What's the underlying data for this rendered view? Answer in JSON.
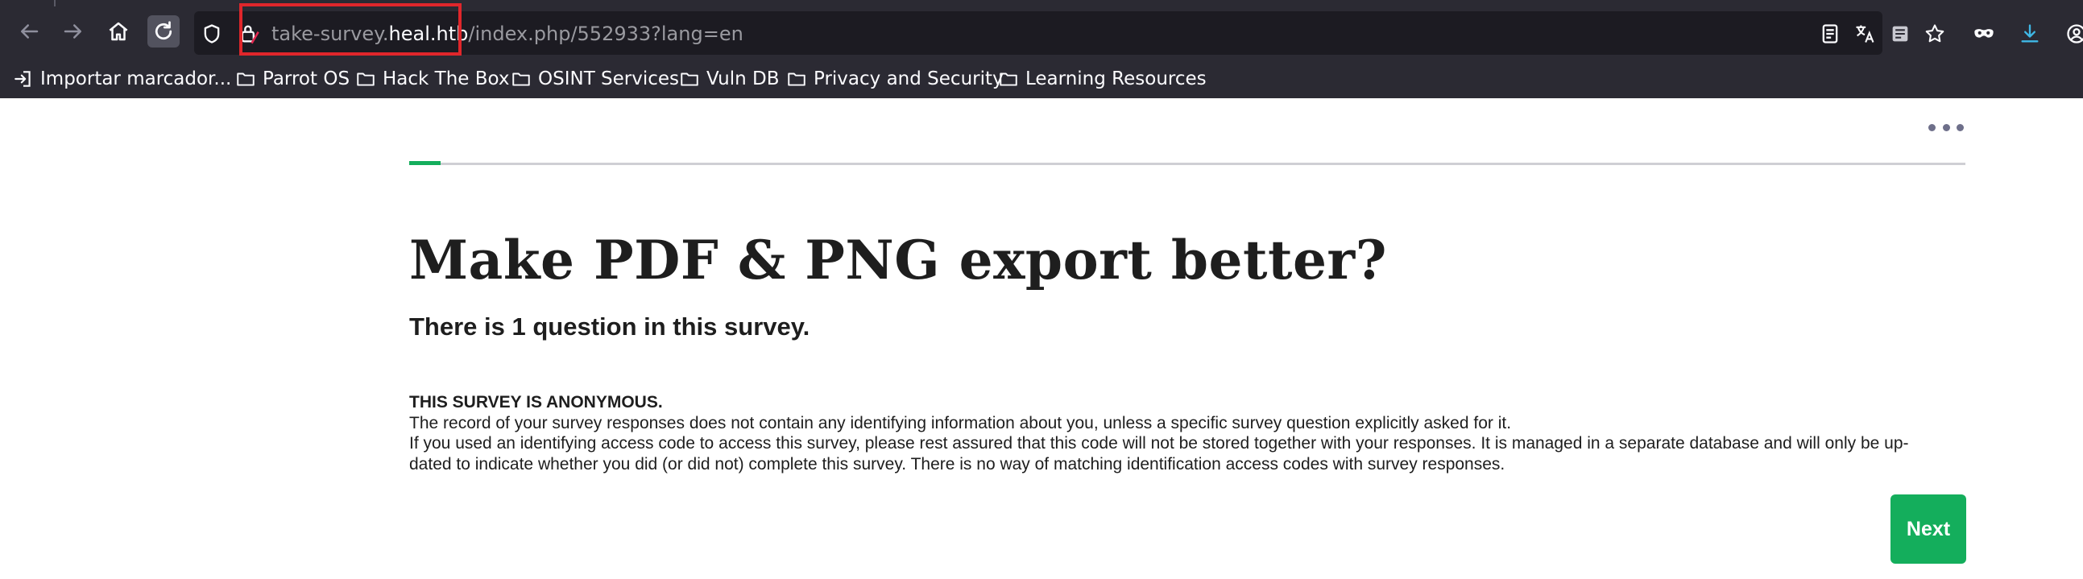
{
  "browser": {
    "url": {
      "prefix": "take-survey.",
      "host": "heal.htb",
      "path": "/index.php/552933?lang=en"
    },
    "nav_icons": [
      "back-arrow-icon",
      "forward-arrow-icon",
      "home-icon",
      "reload-icon"
    ],
    "toolbar_icons": [
      "reader-view-icon",
      "translate-icon",
      "extension-icon",
      "bookmark-star-icon",
      "private-mask-icon",
      "download-icon",
      "account-icon"
    ],
    "accent_download": "#3fb8e6",
    "highlight_color": "#e0262b"
  },
  "bookmarks": [
    {
      "label": "Importar marcador...",
      "icon": "import-icon"
    },
    {
      "label": "Parrot OS",
      "icon": "folder-icon"
    },
    {
      "label": "Hack The Box",
      "icon": "folder-icon"
    },
    {
      "label": "OSINT Services",
      "icon": "folder-icon"
    },
    {
      "label": "Vuln DB",
      "icon": "folder-icon"
    },
    {
      "label": "Privacy and Security",
      "icon": "folder-icon"
    },
    {
      "label": "Learning Resources",
      "icon": "folder-icon"
    }
  ],
  "survey": {
    "progress_fraction": 0.02,
    "title": "Make PDF & PNG export better?",
    "question_count_text": "There is 1 question in this survey.",
    "anonymous_heading": "THIS SURVEY IS ANONYMOUS.",
    "anonymous_lines": [
      "The record of your survey responses does not contain any identifying information about you, unless a specific survey question explicitly asked for it.",
      "If you used an identifying access code to access this survey, please rest assured that this code will not be stored together with your responses. It is managed in a separate database and will only be up-",
      "dated to indicate whether you did (or did not) complete this survey. There is no way of matching identification access codes with survey responses."
    ],
    "next_label": "Next",
    "accent_color": "#14ae5c"
  }
}
